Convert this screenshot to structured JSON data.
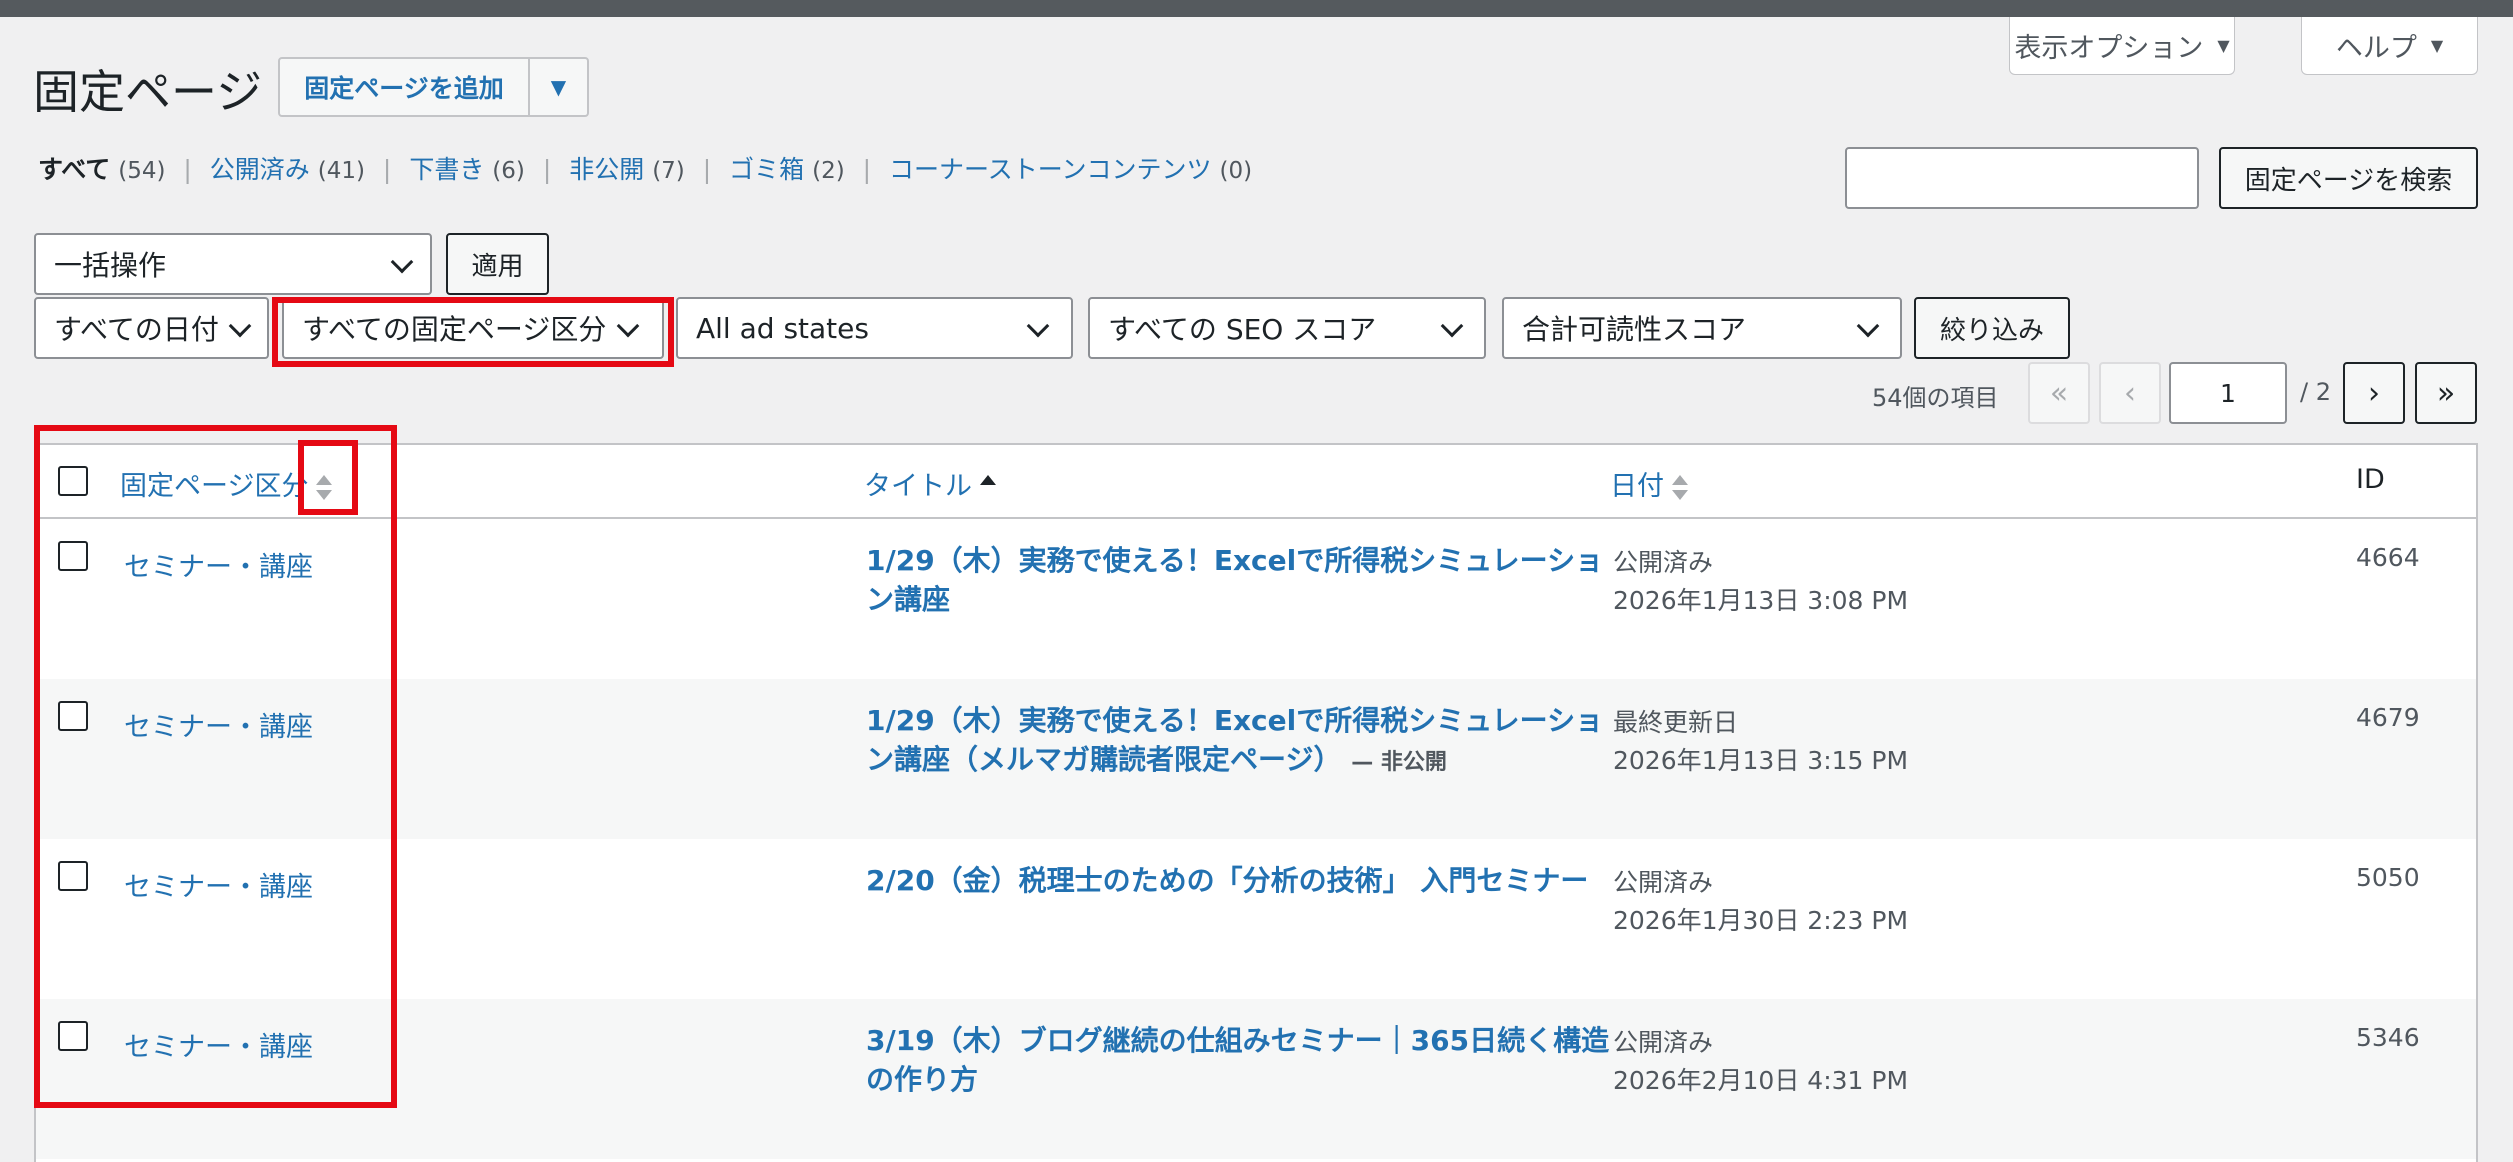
{
  "screen_tabs": {
    "options_label": "表示オプション",
    "help_label": "ヘルプ"
  },
  "header": {
    "title": "固定ページ",
    "add_button": "固定ページを追加"
  },
  "views": [
    {
      "label": "すべて",
      "count": "(54)"
    },
    {
      "label": "公開済み",
      "count": "(41)"
    },
    {
      "label": "下書き",
      "count": "(6)"
    },
    {
      "label": "非公開",
      "count": "(7)"
    },
    {
      "label": "ゴミ箱",
      "count": "(2)"
    },
    {
      "label": "コーナーストーンコンテンツ",
      "count": "(0)"
    }
  ],
  "search": {
    "value": "",
    "button": "固定ページを検索"
  },
  "bulk": {
    "select_value": "一括操作",
    "apply": "適用"
  },
  "filters": {
    "date": "すべての日付",
    "category": "すべての固定ページ区分",
    "ad_states": "All ad states",
    "seo": "すべての SEO スコア",
    "readability": "合計可読性スコア",
    "filter_button": "絞り込み"
  },
  "pagination": {
    "items": "54個の項目",
    "first": "«",
    "prev": "‹",
    "current": "1",
    "total": "/ 2",
    "next": "›",
    "last": "»"
  },
  "table": {
    "columns": {
      "category": "固定ページ区分",
      "title": "タイトル",
      "date": "日付",
      "id": "ID"
    },
    "rows": [
      {
        "category": "セミナー・講座",
        "title": "1/29（木）実務で使える！Excelで所得税シミュレーション講座",
        "state": "",
        "status": "公開済み",
        "date": "2026年1月13日 3:08 PM",
        "id": "4664"
      },
      {
        "category": "セミナー・講座",
        "title": "1/29（木）実務で使える！Excelで所得税シミュレーション講座（メルマガ購読者限定ページ）",
        "state": "— 非公開",
        "status": "最終更新日",
        "date": "2026年1月13日 3:15 PM",
        "id": "4679"
      },
      {
        "category": "セミナー・講座",
        "title": "2/20（金）税理士のための「分析の技術」 入門セミナー",
        "state": "",
        "status": "公開済み",
        "date": "2026年1月30日 2:23 PM",
        "id": "5050"
      },
      {
        "category": "セミナー・講座",
        "title": "3/19（木）ブログ継続の仕組みセミナー｜365日続く構造の作り方",
        "state": "",
        "status": "公開済み",
        "date": "2026年2月10日 4:31 PM",
        "id": "5346"
      }
    ]
  },
  "colors": {
    "link": "#2271b1",
    "highlight": "#e50914",
    "background": "#f0f0f1"
  }
}
